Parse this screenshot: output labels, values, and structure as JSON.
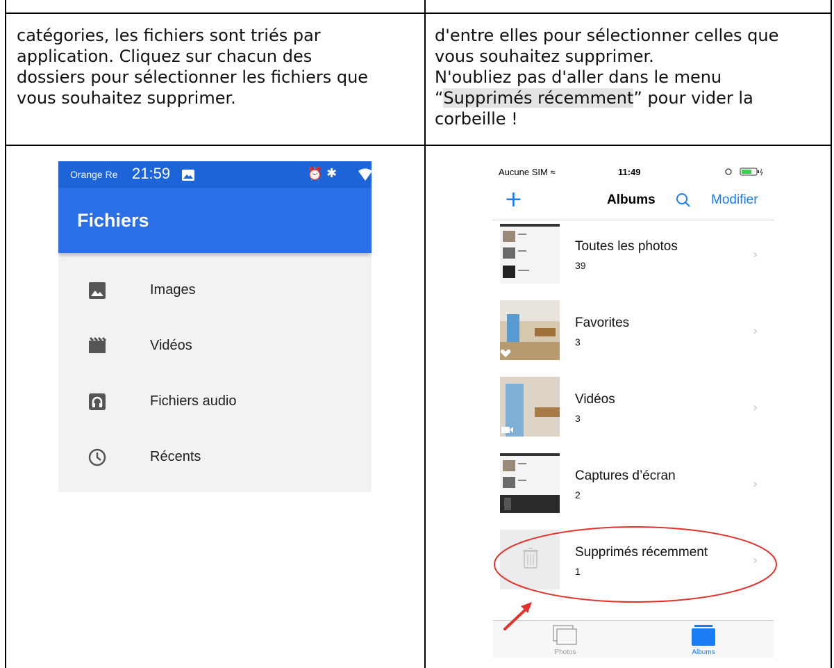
{
  "left_text": [
    "catégories, les fichiers sont triés par",
    "application. Cliquez sur chacun des",
    "dossiers pour sélectionner les fichiers que",
    "vous souhaitez supprimer."
  ],
  "right_text": {
    "line1": "d'entre elles pour sélectionner celles que",
    "line2": "vous souhaitez supprimer.",
    "line3": "N'oubliez pas d'aller dans le menu",
    "line4_prefix": "“",
    "line4_highlight": "Supprimés récemment",
    "line4_suffix": "” pour vider la",
    "line5": "corbeille !"
  },
  "android": {
    "status": {
      "carrier": "Orange Re",
      "time": "21:59"
    },
    "title": "Fichiers",
    "items": [
      {
        "label": "Images",
        "icon": "image-icon"
      },
      {
        "label": "Vidéos",
        "icon": "video-clapper-icon"
      },
      {
        "label": "Fichiers audio",
        "icon": "headphones-icon"
      },
      {
        "label": "Récents",
        "icon": "clock-icon"
      }
    ],
    "colors": {
      "appbar": "#2a6ee8",
      "statusbar": "#1c64d8"
    }
  },
  "ios": {
    "status": {
      "carrier": "Aucune SIM",
      "time": "11:49"
    },
    "nav": {
      "title": "Albums",
      "edit": "Modifier"
    },
    "albums": [
      {
        "name": "Toutes les photos",
        "count": "39"
      },
      {
        "name": "Favorites",
        "count": "3"
      },
      {
        "name": "Vidéos",
        "count": "3"
      },
      {
        "name": "Captures d’écran",
        "count": "2"
      },
      {
        "name": "Supprimés récemment",
        "count": "1"
      }
    ],
    "tabs": [
      {
        "label": "Photos",
        "active": false
      },
      {
        "label": "Albums",
        "active": true
      }
    ],
    "colors": {
      "accent": "#1a7cf5",
      "annotation": "#e2332f"
    }
  }
}
